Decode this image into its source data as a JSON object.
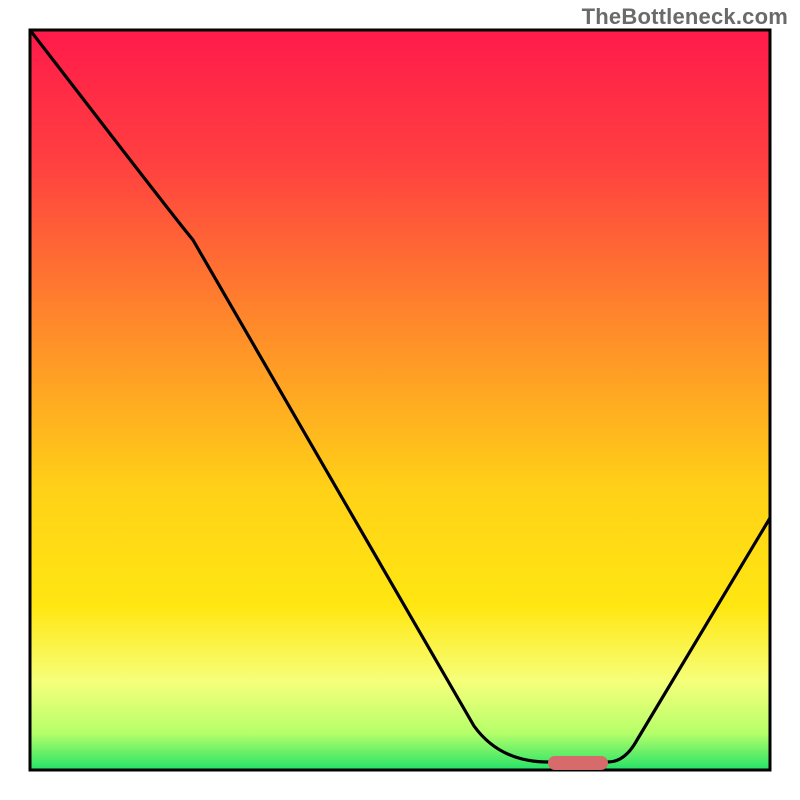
{
  "watermark": "TheBottleneck.com",
  "chart_data": {
    "type": "line",
    "title": "",
    "xlabel": "",
    "ylabel": "",
    "xlim": [
      0,
      100
    ],
    "ylim": [
      0,
      100
    ],
    "grid": false,
    "legend": false,
    "axes_visible": false,
    "series": [
      {
        "name": "bottleneck-curve",
        "x": [
          0,
          10,
          22,
          60,
          70,
          78,
          82,
          100
        ],
        "values": [
          100,
          87,
          74,
          6,
          1,
          1,
          4,
          34
        ]
      }
    ],
    "annotations": [
      {
        "name": "optimal-marker",
        "type": "bar",
        "x_range": [
          70,
          78
        ],
        "y": 1,
        "color": "#d76a6a"
      }
    ],
    "background_gradient": {
      "top": "#ff1a4b",
      "mid1": "#ff8a2a",
      "mid2": "#ffe712",
      "mid3": "#f6ff7a",
      "bottom": "#24e267"
    }
  }
}
